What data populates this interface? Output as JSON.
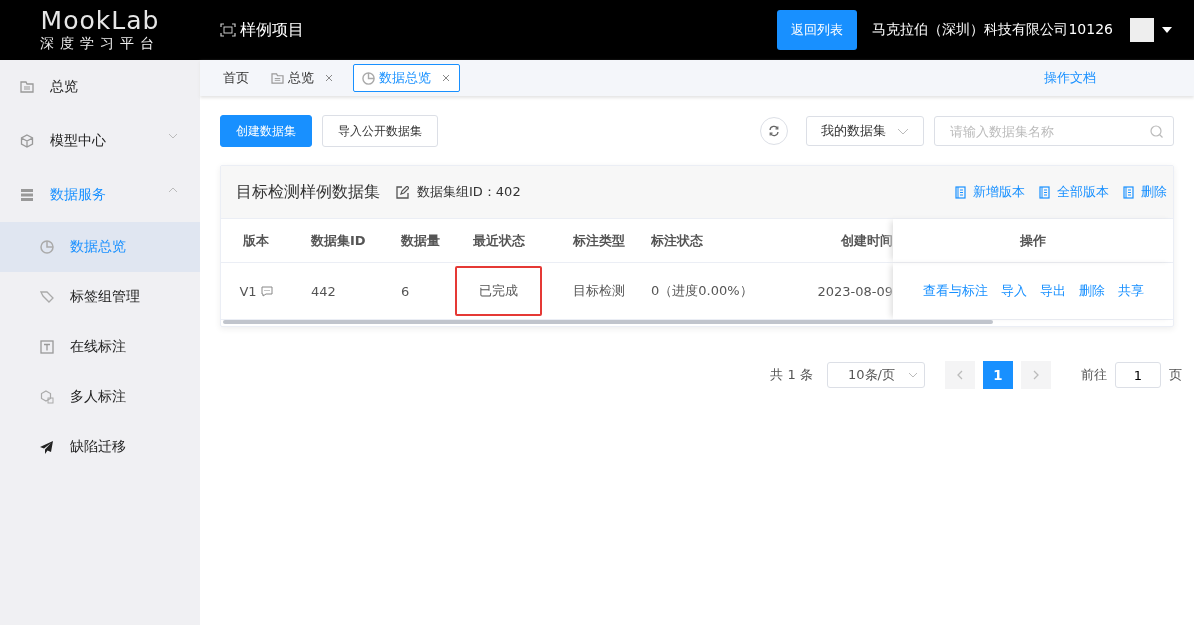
{
  "header": {
    "logo": "MookLab",
    "logo_subtitle": "深度学习平台",
    "project": "样例项目",
    "back_button": "返回列表",
    "company": "马克拉伯（深圳）科技有限公司10126"
  },
  "sidebar": {
    "items": [
      {
        "label": "总览",
        "selected": false
      },
      {
        "label": "模型中心",
        "selected": false,
        "expanded": false
      },
      {
        "label": "数据服务",
        "selected": false,
        "expanded": true,
        "children": [
          {
            "label": "数据总览",
            "selected": true
          },
          {
            "label": "标签组管理",
            "selected": false
          },
          {
            "label": "在线标注",
            "selected": false
          },
          {
            "label": "多人标注",
            "selected": false
          },
          {
            "label": "缺陷迁移",
            "selected": false
          }
        ]
      }
    ]
  },
  "tabs": [
    {
      "label": "首页",
      "selected": false,
      "closable": false
    },
    {
      "label": "总览",
      "selected": false,
      "closable": true
    },
    {
      "label": "数据总览",
      "selected": true,
      "closable": true
    }
  ],
  "docs_link": "操作文档",
  "toolbar": {
    "create_button": "创建数据集",
    "import_button": "导入公开数据集",
    "filter_select": "我的数据集",
    "search": {
      "placeholder": "请输入数据集名称"
    }
  },
  "dataset": {
    "title": "目标检测样例数据集",
    "group_id": "数据集组ID：402",
    "actions": [
      "新增版本",
      "全部版本",
      "删除"
    ],
    "table": {
      "columns": [
        "版本",
        "数据集ID",
        "数据量",
        "最近状态",
        "标注类型",
        "标注状态",
        "创建时间",
        "操作"
      ],
      "rows": [
        {
          "cells": [
            "V1",
            "442",
            "6",
            "已完成",
            "目标检测",
            "0（进度0.00%）",
            "2023-08-09"
          ],
          "status_highlighted": true,
          "actions": [
            "查看与标注",
            "导入",
            "导出",
            "删除",
            "共享"
          ]
        }
      ]
    }
  },
  "pagination": {
    "total": "共 1 条",
    "page_size": "10条/页",
    "pages": [
      {
        "label": "1",
        "selected": true
      }
    ],
    "goto_label": "前往",
    "goto_value": "1",
    "page_suffix": "页"
  }
}
